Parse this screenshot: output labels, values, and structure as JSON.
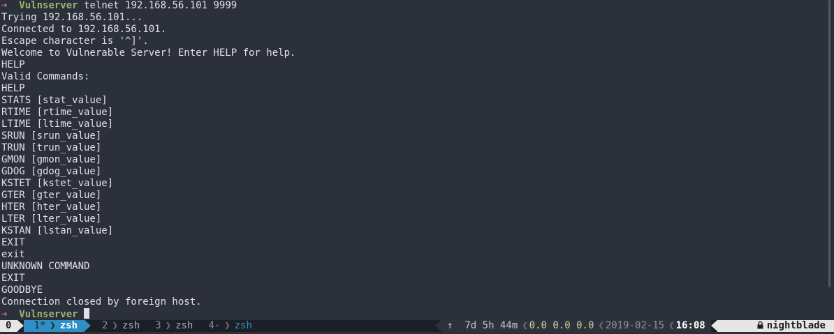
{
  "prompt": {
    "arrow": "➜",
    "directory": "Vulnserver",
    "command": "telnet 192.168.56.101 9999"
  },
  "output_lines": [
    "Trying 192.168.56.101...",
    "Connected to 192.168.56.101.",
    "Escape character is '^]'.",
    "Welcome to Vulnerable Server! Enter HELP for help.",
    "HELP",
    "Valid Commands:",
    "HELP",
    "STATS [stat_value]",
    "RTIME [rtime_value]",
    "LTIME [ltime_value]",
    "SRUN [srun_value]",
    "TRUN [trun_value]",
    "GMON [gmon_value]",
    "GDOG [gdog_value]",
    "KSTET [kstet_value]",
    "GTER [gter_value]",
    "HTER [hter_value]",
    "LTER [lter_value]",
    "KSTAN [lstan_value]",
    "EXIT",
    "exit",
    "UNKNOWN COMMAND",
    "EXIT",
    "GOODBYE",
    "Connection closed by foreign host."
  ],
  "final_prompt": {
    "arrow": "➜",
    "directory": "Vulnserver"
  },
  "statusbar": {
    "session": "0",
    "windows": [
      {
        "index": "1*",
        "name": "zsh",
        "active": true
      },
      {
        "index": "2",
        "name": "zsh",
        "active": false
      },
      {
        "index": "3",
        "name": "zsh",
        "active": false
      },
      {
        "index": "4-",
        "name": "zsh",
        "active": false
      }
    ],
    "uptime": "↑  7d 5h 44m",
    "load": "0.0 0.0 0.0",
    "date": "2019-02-15",
    "time": "16:08",
    "hostname": "nightblade",
    "lock_glyph": "🔒"
  },
  "colors": {
    "background": "#2b303b",
    "prompt_arrow": "#e56a5f",
    "prompt_dir": "#96b56e",
    "active_window": "#2f8fc4"
  }
}
